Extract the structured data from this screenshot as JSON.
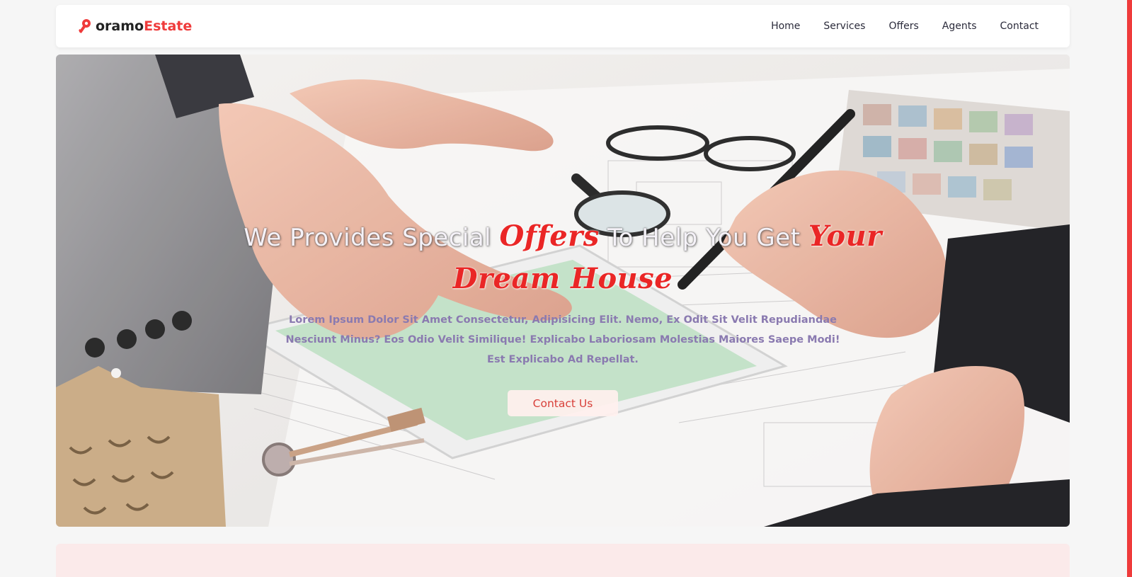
{
  "brand": {
    "prefix": "oramo",
    "suffix": "Estate",
    "primary_color": "#ef3b3b",
    "icon": "key-icon"
  },
  "nav": {
    "items": [
      {
        "label": "Home"
      },
      {
        "label": "Services"
      },
      {
        "label": "Offers"
      },
      {
        "label": "Agents"
      },
      {
        "label": "Contact"
      }
    ]
  },
  "hero": {
    "title_part1": "We Provides Special ",
    "title_accent1": "Offers",
    "title_part2": " To Help You Get ",
    "title_accent2": "Your Dream House",
    "description": "Lorem Ipsum Dolor Sit Amet Consectetur, Adipisicing Elit. Nemo, Ex Odit Sit Velit Repudiandae Nesciunt Minus? Eos Odio Velit Similique! Explicabo Laboriosam Molestias Maiores Saepe Modi! Est Explicabo Ad Repellat.",
    "button_label": "Contact Us",
    "background": "photo of real-estate agents reviewing blueprints with a tablet, keys and magnifying glass"
  },
  "colors": {
    "accent": "#ea2626",
    "hero_text": "#8a7ab0",
    "section_bg": "#fbeaea"
  }
}
